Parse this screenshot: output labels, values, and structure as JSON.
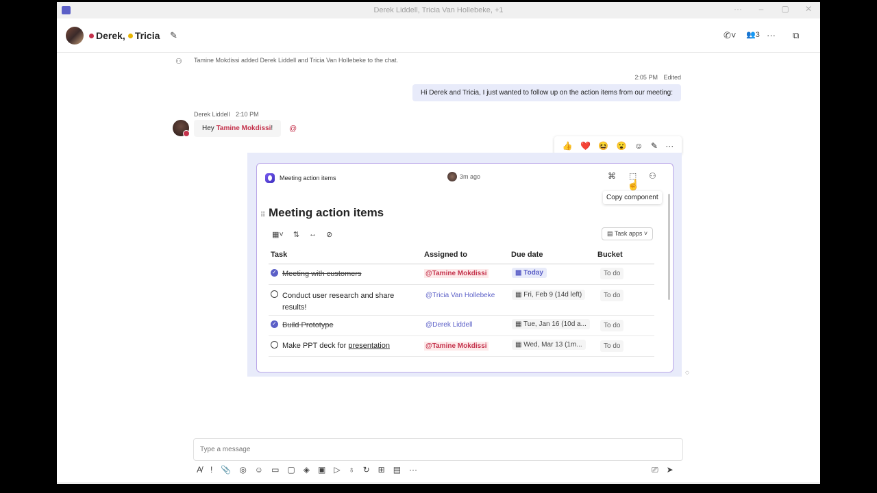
{
  "window": {
    "title": "Derek Liddell, Tricia Van Hollebeke, +1",
    "controls": [
      "···",
      "–",
      "▢",
      "✕"
    ]
  },
  "header": {
    "participants": [
      {
        "name": "Derek",
        "status_color": "#c4314b"
      },
      {
        "name": "Tricia",
        "status_color": "#e8b500"
      }
    ],
    "separator": ",",
    "participant_count": "3",
    "icons": [
      "edit-icon",
      "call-icon",
      "people-icon",
      "more-icon",
      "popout-icon"
    ]
  },
  "messages": {
    "system": "Tamine Mokdissi added Derek Liddell and Tricia Van Hollebeke to the chat.",
    "mine": {
      "time": "2:05 PM",
      "edited": "Edited",
      "text": "Hi Derek and Tricia, I just wanted to follow up on the action items from our meeting:"
    },
    "derek": {
      "sender": "Derek Liddell",
      "time": "2:10 PM",
      "greeting": "Hey ",
      "mention": "Tamine Mokdissi",
      "suffix": "!"
    }
  },
  "reactions": [
    "👍",
    "❤️",
    "😆",
    "😮",
    "☺",
    "✎",
    "···"
  ],
  "loop": {
    "header_label": "Meeting action items",
    "time": "3m ago",
    "tooltip": "Copy component",
    "title": "Meeting action items",
    "task_apps": "Task apps",
    "columns": [
      "Task",
      "Assigned to",
      "Due date",
      "Bucket"
    ],
    "rows": [
      {
        "task": "Meeting with customers",
        "done": true,
        "assignee": "@Tamine Mokdissi",
        "me": true,
        "due": "Today",
        "today": true,
        "bucket": "To do"
      },
      {
        "task": "Conduct user research and share",
        "task2": "results!",
        "done": false,
        "assignee": "@Tricia Van Hollebeke",
        "me": false,
        "due": "Fri, Feb 9 (14d left)",
        "today": false,
        "bucket": "To do"
      },
      {
        "task": "Build Prototype",
        "done": true,
        "assignee": "@Derek Liddell",
        "me": false,
        "due": "Tue, Jan 16 (10d a...",
        "today": false,
        "bucket": "To do"
      },
      {
        "task": "Make PPT deck for ",
        "task_link": "presentation",
        "done": false,
        "assignee": "@Tamine Mokdissi",
        "me": true,
        "due": "Wed, Mar 13 (1m...",
        "today": false,
        "bucket": "To do"
      }
    ]
  },
  "compose": {
    "placeholder": "Type a message"
  }
}
